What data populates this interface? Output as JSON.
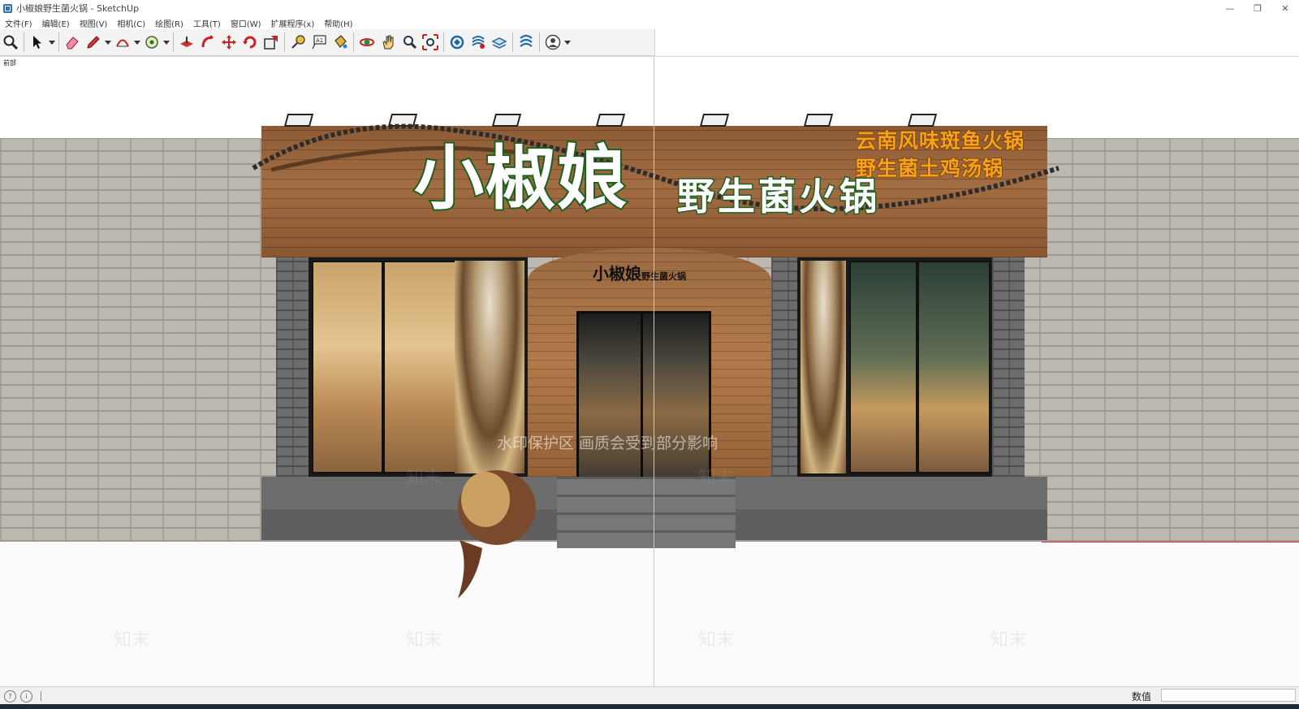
{
  "window": {
    "title": "小椒娘野生菌火锅 - SketchUp",
    "controls": [
      "—",
      "❐",
      "✕"
    ]
  },
  "menu": [
    "文件(F)",
    "编辑(E)",
    "视图(V)",
    "相机(C)",
    "绘图(R)",
    "工具(T)",
    "窗口(W)",
    "扩展程序(x)",
    "帮助(H)"
  ],
  "toolbar": {
    "tools": [
      {
        "name": "zoom-icon"
      },
      {
        "name": "select-icon"
      },
      {
        "name": "eraser-icon"
      },
      {
        "name": "pencil-icon"
      },
      {
        "name": "arc-icon"
      },
      {
        "name": "shape-icon"
      },
      {
        "name": "push-pull-icon"
      },
      {
        "name": "follow-me-icon"
      },
      {
        "name": "move-icon"
      },
      {
        "name": "rotate-icon"
      },
      {
        "name": "scale-icon"
      },
      {
        "name": "tape-measure-icon"
      },
      {
        "name": "text-icon"
      },
      {
        "name": "paint-bucket-icon"
      },
      {
        "name": "orbit-icon"
      },
      {
        "name": "pan-icon"
      },
      {
        "name": "zoom-window-icon"
      },
      {
        "name": "zoom-extents-icon"
      },
      {
        "name": "warehouse-icon"
      },
      {
        "name": "extension-warehouse-icon"
      },
      {
        "name": "layout-icon"
      },
      {
        "name": "extension-manager-icon"
      },
      {
        "name": "account-icon"
      }
    ]
  },
  "viewport": {
    "scene_label": "前部",
    "sign_main": "小椒娘",
    "sign_sub": "野生菌火锅",
    "side_line_1": "云南风味斑鱼火锅",
    "side_line_2": "野生菌土鸡汤锅",
    "door_sign_big": "小椒娘",
    "door_sign_small": "野生菌火锅",
    "watermark": "水印保护区   画质会受到部分影响",
    "watermark_brand": "知末"
  },
  "statusbar": {
    "vcb_label": "数值",
    "vcb_value": ""
  },
  "colors": {
    "sign_green": "#1f5f1f",
    "sign_orange": "#f6a21a",
    "wood": "#a06a3f",
    "axis_red": "#dd3333"
  }
}
